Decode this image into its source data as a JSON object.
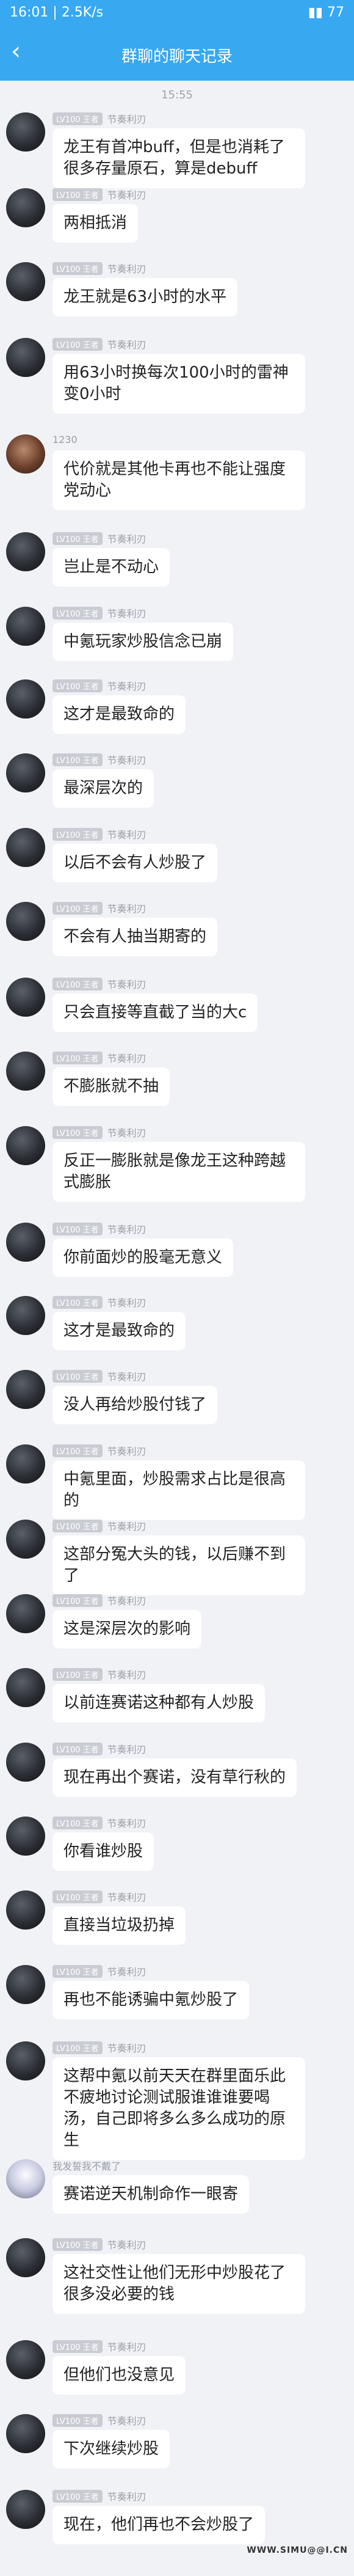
{
  "status_bar": {
    "time_speed": "16:01 | 2.5K/s",
    "right": "▮▮ 77"
  },
  "title_bar": {
    "back_icon": "chevron-left",
    "title": "群聊的聊天记录"
  },
  "timestamp": "15:55",
  "level_badge": "LV100 王者",
  "messages": [
    {
      "nick": "节奏利刃",
      "text": "龙王有首冲buff，但是也消耗了很多存量原石，算是debuff"
    },
    {
      "nick": "节奏利刃",
      "text": "两相抵消"
    },
    {
      "nick": "节奏利刃",
      "text": "龙王就是63小时的水平"
    },
    {
      "nick": "节奏利刃",
      "text": "用63小时换每次100小时的雷神变0小时"
    },
    {
      "nick": "1230",
      "text": "代价就是其他卡再也不能让强度党动心"
    },
    {
      "nick": "节奏利刃",
      "text": "岂止是不动心"
    },
    {
      "nick": "节奏利刃",
      "text": "中氪玩家炒股信念已崩"
    },
    {
      "nick": "节奏利刃",
      "text": "这才是最致命的"
    },
    {
      "nick": "节奏利刃",
      "text": "最深层次的"
    },
    {
      "nick": "节奏利刃",
      "text": "以后不会有人炒股了"
    },
    {
      "nick": "节奏利刃",
      "text": "不会有人抽当期寄的"
    },
    {
      "nick": "节奏利刃",
      "text": "只会直接等直截了当的大c"
    },
    {
      "nick": "节奏利刃",
      "text": "不膨胀就不抽"
    },
    {
      "nick": "节奏利刃",
      "text": "反正一膨胀就是像龙王这种跨越式膨胀"
    },
    {
      "nick": "节奏利刃",
      "text": "你前面炒的股毫无意义"
    },
    {
      "nick": "节奏利刃",
      "text": "这才是最致命的"
    },
    {
      "nick": "节奏利刃",
      "text": "没人再给炒股付钱了"
    },
    {
      "nick": "节奏利刃",
      "text": "中氪里面，炒股需求占比是很高的"
    },
    {
      "nick": "节奏利刃",
      "text": "这部分冤大头的钱，以后赚不到了"
    },
    {
      "nick": "节奏利刃",
      "text": "这是深层次的影响"
    },
    {
      "nick": "节奏利刃",
      "text": "以前连赛诺这种都有人炒股"
    },
    {
      "nick": "节奏利刃",
      "text": "现在再出个赛诺，没有草行秋的"
    },
    {
      "nick": "节奏利刃",
      "text": "你看谁炒股"
    },
    {
      "nick": "节奏利刃",
      "text": "直接当垃圾扔掉"
    },
    {
      "nick": "节奏利刃",
      "text": "再也不能诱骗中氪炒股了"
    },
    {
      "nick": "节奏利刃",
      "text": "这帮中氪以前天天在群里面乐此不疲地讨论测试服谁谁谁要喝汤，自己即将多么多么成功的原生"
    },
    {
      "nick": "我发誓我不戴了",
      "text": "赛诺逆天机制命作一眼寄"
    },
    {
      "nick": "节奏利刃",
      "text": "这社交性让他们无形中炒股花了很多没必要的钱"
    },
    {
      "nick": "节奏利刃",
      "text": "但他们也没意见"
    },
    {
      "nick": "节奏利刃",
      "text": "下次继续炒股"
    },
    {
      "nick": "节奏利刃",
      "text": "现在，他们再也不会炒股了"
    }
  ],
  "watermark": "WWW.SIMU@@I.CN"
}
